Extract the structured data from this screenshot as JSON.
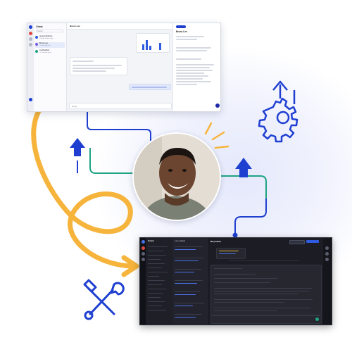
{
  "colors": {
    "accent_blue": "#1f3fd1",
    "line_green": "#1fa383",
    "curve_orange": "#f6b43c",
    "dark_bg": "#1a1b22",
    "light_bg": "#f4f5f8"
  },
  "icons": {
    "gear_upload": "gear-with-up-arrow-icon",
    "tools": "wrench-and-screwdriver-icon",
    "arrow_up_left": "up-arrow-icon",
    "arrow_up_right": "up-arrow-icon",
    "sparkle": "sparkle-rays-icon"
  },
  "light_screenshot": {
    "list_title": "Chats",
    "search_placeholder": "Search",
    "conversations": [
      {
        "name": "Jessica Roberts",
        "sub": "Thanks for the reply"
      },
      {
        "name": "Bruno Lee",
        "sub": "I need help with"
      },
      {
        "name": "Cynthia Bell",
        "sub": "Ok, sounds good"
      }
    ],
    "chat_name": "Bruno Lee",
    "side_name": "Bruno Lee",
    "compose_placeholder": "Reply"
  },
  "dark_screenshot": {
    "tree_title": "Tickets",
    "list_header": "Last updated",
    "message_sender": "Mary Adams"
  }
}
